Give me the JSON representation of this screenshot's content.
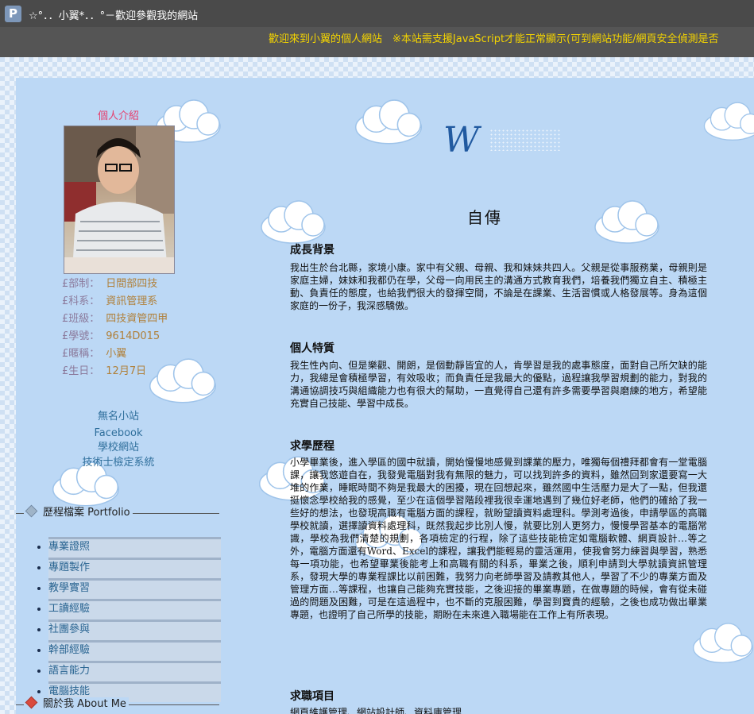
{
  "window": {
    "title": "☆°．．小翼*．．°－歡迎參觀我的網站",
    "app_icon": "P"
  },
  "marquee": {
    "text": "歡迎來到小翼的個人網站　※本站需支援JavaScript才能正常顯示(可到網站功能/網頁安全偵測是否"
  },
  "sidebar": {
    "profile_title": "個人介紹",
    "info": [
      {
        "label": "£部制：",
        "value": "日間部四技"
      },
      {
        "label": "£科系：",
        "value": "資訊管理系"
      },
      {
        "label": "£班級：",
        "value": "四技資管四甲"
      },
      {
        "label": "£學號：",
        "value": "9614D015"
      },
      {
        "label": "£暱稱：",
        "value": "小翼"
      },
      {
        "label": "£生日：",
        "value": "12月7日"
      }
    ],
    "links": [
      "無名小站",
      "Facebook",
      "學校網站",
      "技術士檢定系統"
    ],
    "portfolio_title": "歷程檔案 Portfolio",
    "portfolio_items": [
      "專業證照",
      "專題製作",
      "教學實習",
      "工讀經驗",
      "社團參與",
      "幹部經驗",
      "語言能力",
      "電腦技能"
    ],
    "about_title": "關於我 About Me"
  },
  "main": {
    "logo_letter": "W",
    "title": "自傳",
    "sections": [
      {
        "heading": "成長背景",
        "body": "我出生於台北縣，家境小康。家中有父親、母親、我和妹妹共四人。父親是從事服務業，母親則是家庭主婦，妹妹和我都仍在學，父母一向用民主的溝通方式教育我們，培養我們獨立自主、積極主動、負責任的態度，也給我們很大的發揮空間，不論是在課業、生活習慣或人格發展等。身為這個家庭的一份子，我深感驕傲。"
      },
      {
        "heading": "個人特質",
        "body": "我生性內向、但是樂觀、開朗，是個動靜皆宜的人，肯學習是我的處事態度，面對自己所欠缺的能力，我總是會積極學習，有效吸收；而負責任是我最大的優點，過程讓我學習規劃的能力，對我的溝通協調技巧與組織能力也有很大的幫助，一直覺得自己還有許多需要學習與磨練的地方，希望能充實自己技能、學習中成長。"
      },
      {
        "heading": "求學歷程",
        "body": "小學畢業後，進入學區的國中就讀，開始慢慢地感覺到課業的壓力，唯獨每個禮拜都會有一堂電腦課，讓我悠遊自在，我發覺電腦對我有無限的魅力，可以找到許多的資料，雖然回到家還要寫一大堆的作業，睡眠時間不夠是我最大的困擾，現在回想起來，雖然國中生活壓力是大了一點，但我還挺懷念學校給我的感覺，至少在這個學習階段裡我很幸運地遇到了幾位好老師，他們的確給了我一些好的想法，也發現高職有電腦方面的課程，就盼望讀資料處理科。學測考過後，申請學區的高職學校就讀，選擇讀資料處理科，既然我起步比別人慢，就要比別人更努力，慢慢學習基本的電腦常識，學校為我們清楚的規劃，各項檢定的行程，除了這些技能檢定如電腦軟體、網頁設計…等之外，電腦方面還有Word、Excel的課程，讓我們能輕易的靈活運用，使我會努力練習與學習，熟悉每一項功能，也希望畢業後能考上和高職有關的科系，畢業之後，順利申請到大學就讀資訊管理系，發現大學的專業程課比以前困難，我努力向老師學習及請教其他人，學習了不少的專業方面及管理方面…等課程，也讓自己能夠充實技能，之後迎接的畢業專題，在做專題的時候，會有從未碰過的問題及困難，可是在這過程中，也不斷的克服困難，學習到寶貴的經驗，之後也成功做出畢業專題，也證明了自己所學的技能，期盼在未來進入職場能在工作上有所表現。"
      },
      {
        "heading": "求職項目",
        "body": "網頁維護管理、網站設計師、資料庫管理"
      }
    ]
  },
  "colors": {
    "accent_pink": "#e63f6d",
    "link_blue": "#2f6f9c",
    "page_bg": "#bcd8f5",
    "marquee_yellow": "#f4d400"
  }
}
